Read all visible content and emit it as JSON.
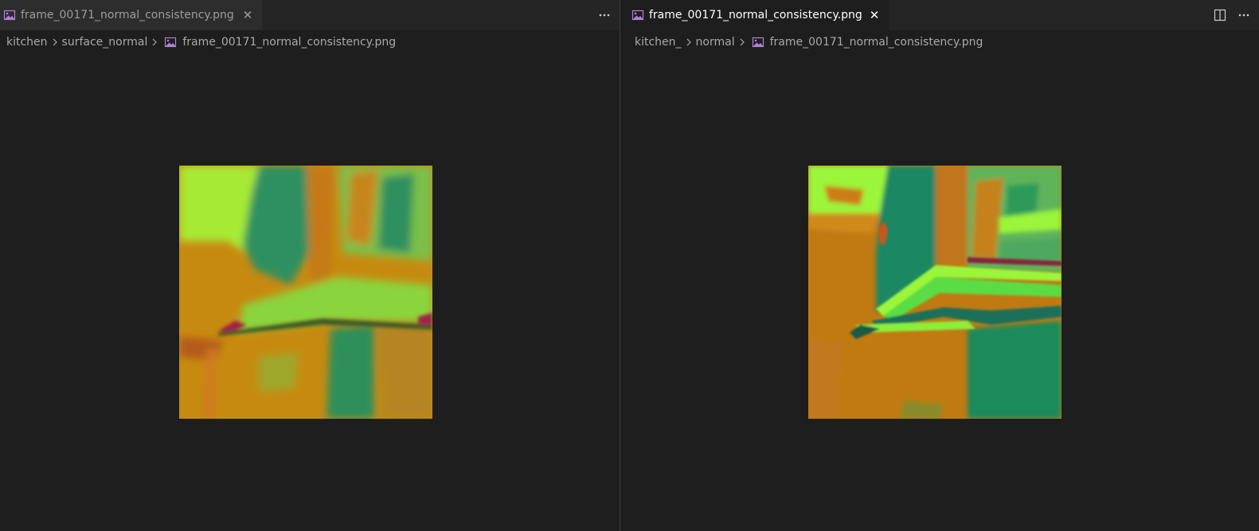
{
  "left_group": {
    "tab": {
      "label": "frame_00171_normal_consistency.png",
      "icon": "image-file-icon",
      "close": "close-icon"
    },
    "actions": {
      "more": "more-actions-icon"
    },
    "breadcrumb": {
      "items": [
        "kitchen",
        "surface_normal"
      ],
      "file": "frame_00171_normal_consistency.png"
    },
    "image": "normal-map-preview"
  },
  "right_group": {
    "tab": {
      "label": "frame_00171_normal_consistency.png",
      "icon": "image-file-icon",
      "close": "close-icon"
    },
    "actions": {
      "split": "split-editor-icon",
      "more": "more-actions-icon"
    },
    "breadcrumb": {
      "items": [
        "kitchen_",
        "normal"
      ],
      "file": "frame_00171_normal_consistency.png"
    },
    "image": "normal-map-preview"
  },
  "colors": {
    "editor_bg": "#1e1e1e",
    "tabbar_bg": "#252526",
    "inactive_tab_bg": "#2d2d2d",
    "image_icon": "#b180d7",
    "normal_orange": "#c78a10",
    "normal_green": "#1f8a5a",
    "normal_lime": "#9af53a",
    "normal_magenta": "#a0204a"
  }
}
